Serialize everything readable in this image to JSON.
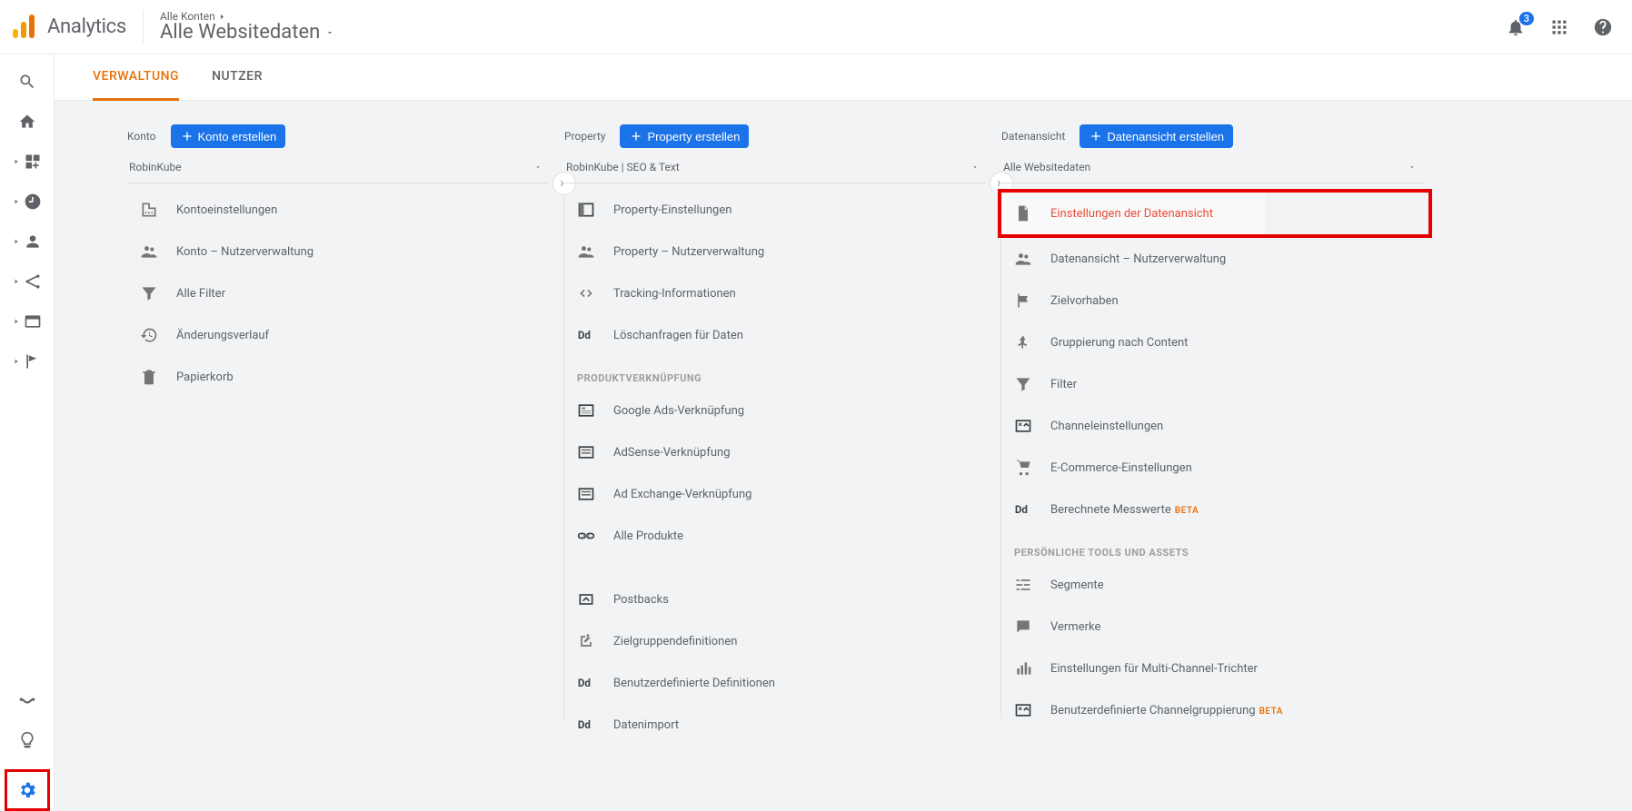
{
  "header": {
    "brand": "Analytics",
    "account_crumb": "Alle Konten",
    "view_name": "Alle Websitedaten",
    "notif_count": "3"
  },
  "tabs": {
    "admin": "VERWALTUNG",
    "user": "NUTZER"
  },
  "cols": {
    "account": {
      "label": "Konto",
      "btn": "Konto erstellen",
      "selected": "RobinKube",
      "items": [
        {
          "icon": "office",
          "label": "Kontoeinstellungen"
        },
        {
          "icon": "users",
          "label": "Konto – Nutzerverwaltung"
        },
        {
          "icon": "filter",
          "label": "Alle Filter"
        },
        {
          "icon": "history",
          "label": "Änderungsverlauf"
        },
        {
          "icon": "trash",
          "label": "Papierkorb"
        }
      ]
    },
    "property": {
      "label": "Property",
      "btn": "Property erstellen",
      "selected": "RobinKube | SEO & Text",
      "items": [
        {
          "icon": "panel",
          "label": "Property-Einstellungen"
        },
        {
          "icon": "users",
          "label": "Property – Nutzerverwaltung"
        },
        {
          "icon": "code",
          "label": "Tracking-Informationen"
        },
        {
          "icon": "dd",
          "label": "Löschanfragen für Daten"
        }
      ],
      "sect1": "PRODUKTVERKNÜPFUNG",
      "items2": [
        {
          "icon": "ads",
          "label": "Google Ads-Verknüpfung"
        },
        {
          "icon": "list",
          "label": "AdSense-Verknüpfung"
        },
        {
          "icon": "list",
          "label": "Ad Exchange-Verknüpfung"
        },
        {
          "icon": "link",
          "label": "Alle Produkte"
        }
      ],
      "items3": [
        {
          "icon": "post",
          "label": "Postbacks"
        },
        {
          "icon": "target",
          "label": "Zielgruppendefinitionen"
        },
        {
          "icon": "dd",
          "label": "Benutzerdefinierte Definitionen"
        },
        {
          "icon": "dd",
          "label": "Datenimport"
        }
      ]
    },
    "view": {
      "label": "Datenansicht",
      "btn": "Datenansicht erstellen",
      "selected": "Alle Websitedaten",
      "items": [
        {
          "icon": "doc",
          "label": "Einstellungen der Datenansicht",
          "sel": true,
          "hl": true
        },
        {
          "icon": "users",
          "label": "Datenansicht – Nutzerverwaltung"
        },
        {
          "icon": "flag",
          "label": "Zielvorhaben"
        },
        {
          "icon": "person",
          "label": "Gruppierung nach Content"
        },
        {
          "icon": "filter",
          "label": "Filter"
        },
        {
          "icon": "chan",
          "label": "Channeleinstellungen"
        },
        {
          "icon": "cart",
          "label": "E-Commerce-Einstellungen"
        },
        {
          "icon": "dd",
          "label": "Berechnete Messwerte",
          "beta": "BETA"
        }
      ],
      "sect1": "PERSÖNLICHE TOOLS UND ASSETS",
      "items2": [
        {
          "icon": "seg",
          "label": "Segmente"
        },
        {
          "icon": "note",
          "label": "Vermerke"
        },
        {
          "icon": "bars",
          "label": "Einstellungen für Multi-Channel-Trichter"
        },
        {
          "icon": "chan",
          "label": "Benutzerdefinierte Channelgruppierung",
          "beta": "BETA"
        }
      ]
    }
  }
}
